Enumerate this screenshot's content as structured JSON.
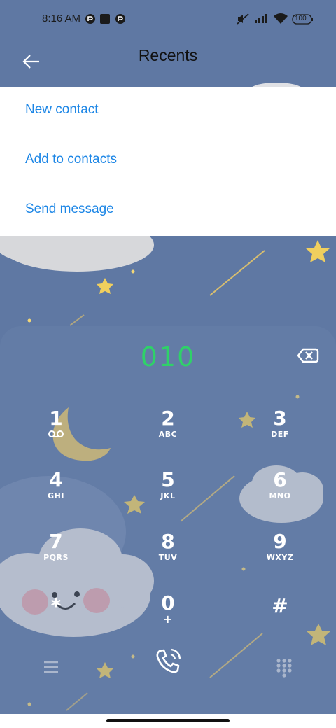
{
  "status_bar": {
    "time": "8:16 AM",
    "battery": "100",
    "icons": [
      "notification-icon",
      "app-icon",
      "notification-icon",
      "mute-icon",
      "signal-icon",
      "wifi-icon",
      "battery-icon"
    ]
  },
  "header": {
    "title": "Recents",
    "back_icon": "arrow-left-icon"
  },
  "menu": {
    "items": [
      {
        "label": "New contact"
      },
      {
        "label": "Add to contacts"
      },
      {
        "label": "Send message"
      }
    ]
  },
  "dialer": {
    "number": "010",
    "keys": [
      {
        "digit": "1",
        "letters": ""
      },
      {
        "digit": "2",
        "letters": "ABC"
      },
      {
        "digit": "3",
        "letters": "DEF"
      },
      {
        "digit": "4",
        "letters": "GHI"
      },
      {
        "digit": "5",
        "letters": "JKL"
      },
      {
        "digit": "6",
        "letters": "MNO"
      },
      {
        "digit": "7",
        "letters": "PQRS"
      },
      {
        "digit": "8",
        "letters": "TUV"
      },
      {
        "digit": "9",
        "letters": "WXYZ"
      },
      {
        "digit": "*",
        "letters": ""
      },
      {
        "digit": "0",
        "letters": "+"
      },
      {
        "digit": "#",
        "letters": ""
      }
    ]
  },
  "colors": {
    "background": "#5f78a3",
    "menu_text": "#1c86e6",
    "number": "#2fd169",
    "star": "#f0cf5e",
    "moon": "#e9c766"
  }
}
